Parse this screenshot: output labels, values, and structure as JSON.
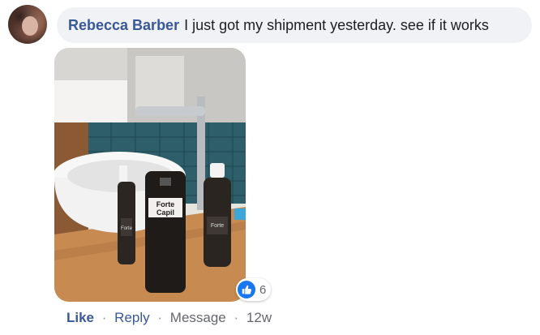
{
  "comment": {
    "author": "Rebecca Barber",
    "text": "I just got my shipment yesterday. see if it works"
  },
  "photo": {
    "product_brand": "Forte Capil",
    "product_labels": [
      "Forte Capil",
      "Forte Capil",
      "Forte Capil"
    ]
  },
  "reactions": {
    "icon": "thumbs-up-icon",
    "count": "6",
    "color": "#1877f2"
  },
  "actions": {
    "like": "Like",
    "reply": "Reply",
    "message": "Message",
    "age": "12w",
    "separator": "·"
  },
  "colors": {
    "link": "#385898",
    "bubble": "#f0f2f5",
    "muted": "#65676b"
  }
}
